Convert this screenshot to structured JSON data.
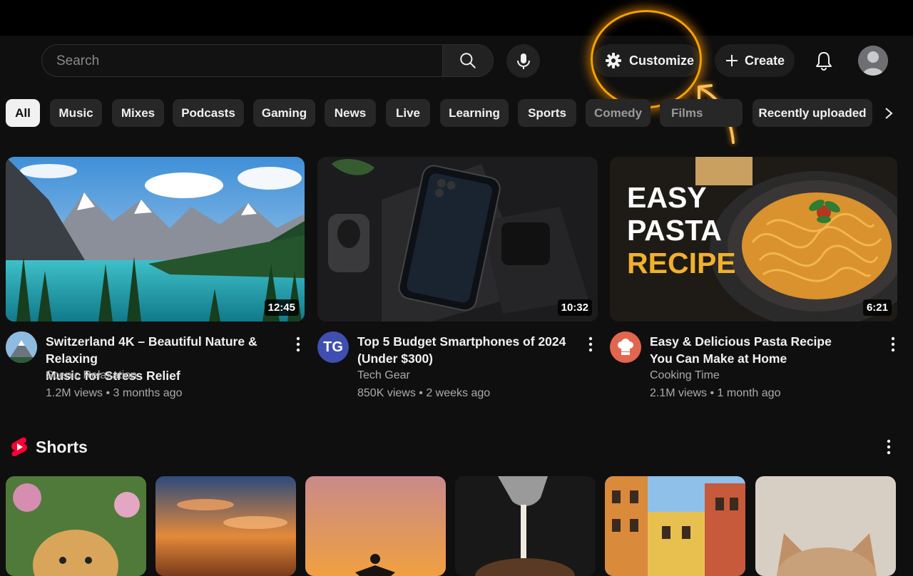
{
  "header": {
    "search_placeholder": "Search",
    "customize_label": "Customize",
    "create_label": "Create"
  },
  "chips": [
    "All",
    "Music",
    "Mixes",
    "Podcasts",
    "Gaming",
    "News",
    "Live",
    "Learning",
    "Sports",
    "Comedy",
    "Films",
    "Recently uploaded"
  ],
  "videos": [
    {
      "title_line1": "Switzerland 4K – Beautiful Nature & Relaxing",
      "title_line2": "Music for Stress Relief",
      "channel": "Scenic Relaxation",
      "meta": "1.2M views • 3 months ago",
      "duration": "12:45"
    },
    {
      "title_line1": "Top 5 Budget Smartphones of 2024",
      "title_line2": "(Under $300)",
      "channel": "Tech Gear",
      "channel_initials": "TG",
      "meta": "850K views • 2 weeks ago",
      "duration": "10:32"
    },
    {
      "title_line1": "Easy & Delicious Pasta Recipe",
      "title_line2": "You Can Make at Home",
      "channel": "Cooking Time",
      "meta": "2.1M views • 1 month ago",
      "duration": "6:21",
      "thumb_text": [
        "EASY",
        "PASTA",
        "RECIPE"
      ]
    }
  ],
  "shorts": {
    "title": "Shorts"
  },
  "colors": {
    "background": "#0f0f0f",
    "chip": "#272727",
    "highlight_ring": "#f5a300",
    "shorts_red": "#ff0033"
  }
}
